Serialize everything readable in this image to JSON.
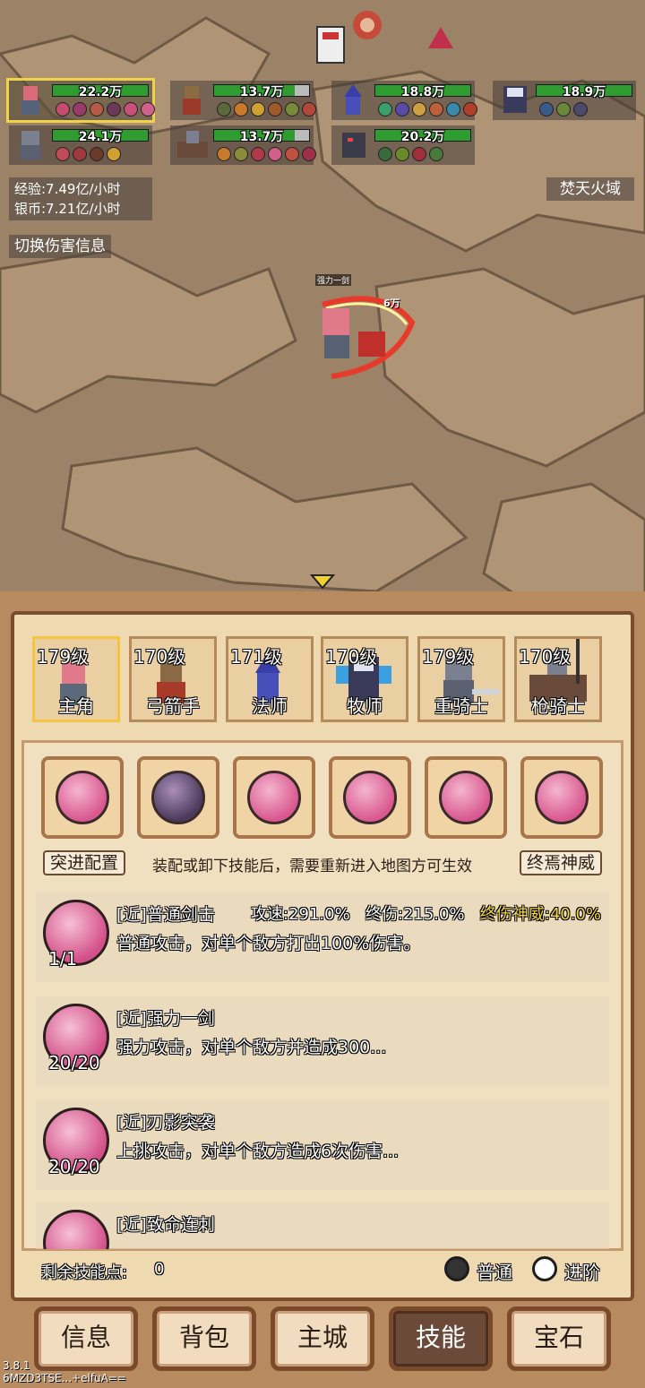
{
  "team": [
    {
      "hp": "22.2万",
      "selected": true
    },
    {
      "hp": "13.7万"
    },
    {
      "hp": "18.8万"
    },
    {
      "hp": "18.9万"
    },
    {
      "hp": "24.1万"
    },
    {
      "hp": "13.7万"
    },
    {
      "hp": "20.2万"
    }
  ],
  "stats": {
    "exp": "经验:7.49亿/小时",
    "silver": "银币:7.21亿/小时"
  },
  "zone_name": "焚天火域",
  "toggle_damage": "切换伤害信息",
  "battle": {
    "skill_popup": "强力一剑",
    "damage_popup": "6万"
  },
  "characters": [
    {
      "level": "179级",
      "name": "主角"
    },
    {
      "level": "170级",
      "name": "弓箭手"
    },
    {
      "level": "171级",
      "name": "法师"
    },
    {
      "level": "170级",
      "name": "牧师"
    },
    {
      "level": "179级",
      "name": "重骑士"
    },
    {
      "level": "170级",
      "name": "枪骑士"
    }
  ],
  "skill_config": {
    "left_tag": "突进配置",
    "tip": "装配或卸下技能后，需要重新进入地图方可生效",
    "right_tag": "终焉神威"
  },
  "skills": [
    {
      "name": "[近]普通剑击",
      "count": "1/1",
      "desc": "普通攻击，对单个敌方打出100%伤害。",
      "speed": "攻速:291.0%",
      "final": "终伤:215.0%",
      "god": "终伤神威:40.0%"
    },
    {
      "name": "[近]强力一剑",
      "count": "20/20",
      "desc": "强力攻击，对单个敌方并造成300..."
    },
    {
      "name": "[近]刃影突袭",
      "count": "20/20",
      "desc": "上挑攻击，对单个敌方造成6次伤害..."
    },
    {
      "name": "[近]致命连刺",
      "count": "",
      "desc": ""
    }
  ],
  "skill_points": {
    "label": "剩余技能点:",
    "value": "0"
  },
  "mode": {
    "normal": "普通",
    "advanced": "进阶"
  },
  "nav": [
    "信息",
    "背包",
    "主城",
    "技能",
    "宝石"
  ],
  "nav_active": 3,
  "version": {
    "number": "3.8.1",
    "code": "6MZD3TSE...+elfuA=="
  },
  "colors": {
    "hp": "#2f9c2f",
    "active_border": "#f5c542",
    "god_text": "#f5d742"
  }
}
